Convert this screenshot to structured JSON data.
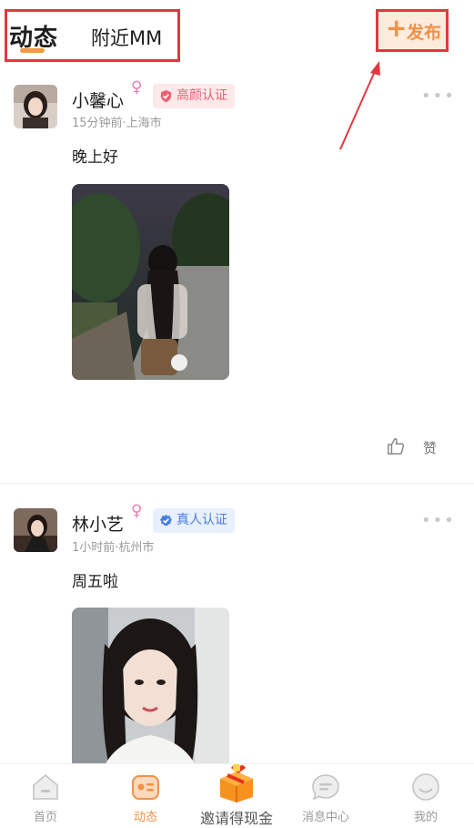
{
  "header": {
    "tab_active": "动态",
    "tab_other": "附近MM",
    "publish_plus": "+",
    "publish_label": "发布"
  },
  "posts": [
    {
      "name": "小馨心",
      "gender_symbol": "♀",
      "badge": "高颜认证",
      "meta": "15分钟前·上海市",
      "more": "•••",
      "text": "晚上好",
      "like_label": "赞"
    },
    {
      "name": "林小艺",
      "gender_symbol": "♀",
      "badge": "真人认证",
      "meta": "1小时前·杭州市",
      "more": "•••",
      "text": "周五啦"
    }
  ],
  "nav": {
    "home": "首页",
    "feed": "动态",
    "invite": "邀请得现金",
    "messages": "消息中心",
    "mine": "我的"
  },
  "colors": {
    "accent": "#f29045",
    "annotation_red": "#e0393f",
    "badge_pink": "#ec6173",
    "badge_blue": "#4a7ee0"
  }
}
